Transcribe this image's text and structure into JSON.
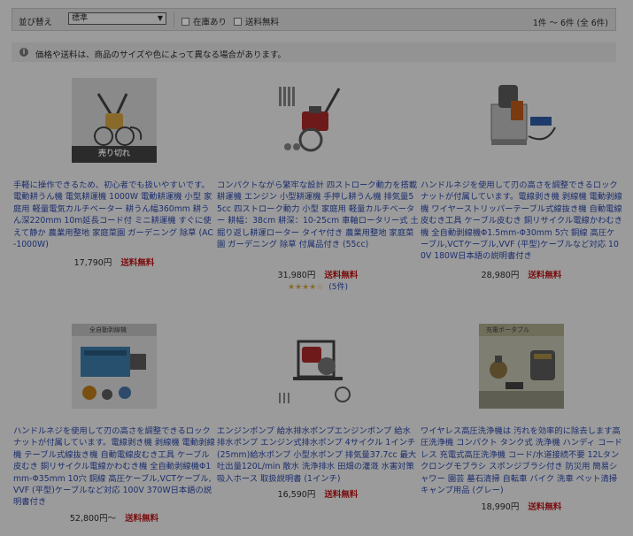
{
  "toolbar": {
    "sort_label": "並び替え",
    "sort_value": "標準",
    "in_stock_label": "在庫あり",
    "free_shipping_label": "送料無料",
    "count_text": "1件 ～ 6件 (全 6件)"
  },
  "notice": {
    "text": "価格や送料は、商品のサイズや色によって異なる場合があります。"
  },
  "products": [
    {
      "title": "手軽に操作できるため、初心者でも扱いやすいです。電動耕うん機 電気耕運機 1000W 電動耕運機 小型 家庭用 軽量電気カルチベーター 耕うん幅360mm 耕うん深220mm 10m延長コード付 ミニ耕運機 すぐに使えて静か 農業用整地 家庭菜園 ガーデニング 除草 (AC-1000W)",
      "price": "17,790円",
      "shipping": "送料無料",
      "badge": "売り切れ"
    },
    {
      "title": "コンパクトながら繁牢な設計 四ストローク動力を搭載耕運機 エンジン 小型耕運機 手押し耕うん機 排気量55cc 四ストローク動力 小型 家庭用 軽量カルチベーター 耕幅：38cm 耕深：10-25cm 車軸ロータリー式 土掘り返し耕運ローター タイヤ付き 農業用整地 家庭菜園 ガーデニング 除草 付属品付き (55cc)",
      "price": "31,980円",
      "shipping": "送料無料",
      "rating": 4,
      "reviews": "(5件)"
    },
    {
      "title": "ハンドルネジを使用して刃の高さを調整できるロックナットが付属しています。電線剥き機 剥線機 電動剥線機 ワイヤーストリッパーテーブル式線抜き機 自動電線皮むき工具 ケーブル皮むき 銅リサイクル電線かわむき機 全自動剥線機Φ1.5mm-Φ30mm 5穴 銅線 高圧ケーブル,VCTケーブル,VVF (平型)ケーブルなど対応 100V 180W日本語の説明書付き",
      "price": "28,980円",
      "shipping": "送料無料"
    },
    {
      "title": "ハンドルネジを使用して刃の高さを調整できるロックナットが付属しています。電線剥き機 剥線機 電動剥線機 テーブル式線抜き機 自動電線皮むき工具 ケーブル皮むき 銅リサイクル電線かわむき機 全自動剥線機Φ1mm-Φ35mm 10穴 銅線 高圧ケーブル,VCTケーブル,VVF (平型)ケーブルなど対応 100V 370W日本語の説明書付き",
      "price": "52,800円～",
      "shipping": "送料無料",
      "thumb_caption": "全自動剥線機"
    },
    {
      "title": "エンジンポンプ 給水排水ポンプエンジンポンプ 給水排水ポンプ エンジン式排水ポンプ 4サイクル 1インチ(25mm)給水ポンプ 小型水ポンプ 排気量37.7cc 最大吐出量120L/min 散水 洗浄排水 田畑の灌漑 水害対策 吸入ホース 取扱説明書 (1インチ)",
      "price": "16,590円",
      "shipping": "送料無料"
    },
    {
      "title": "ワイヤレス高圧洗浄機は 汚れを効率的に除去します高圧洗浄機 コンパクト タンク式 洗浄機 ハンディ コードレス 充電式高圧洗浄機 コード/水道接続不要 12Lタンクロングモブラシ スポンジブラシ付き 防災用 簡易シャワー 園芸 墓石清掃 自転車 バイク 洗車 ペット清掃 キャンプ用品 (グレー)",
      "price": "18,990円",
      "shipping": "送料無料",
      "thumb_caption": "充電ポータブル"
    }
  ]
}
